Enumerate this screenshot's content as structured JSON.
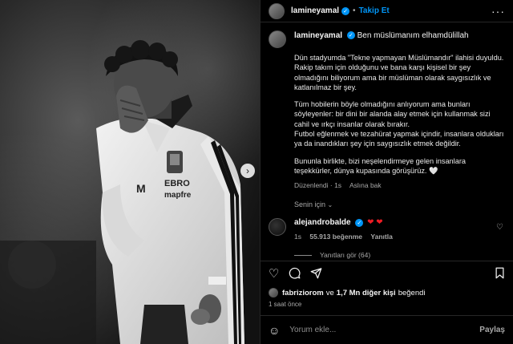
{
  "header": {
    "username": "lamineyamal",
    "separator": "•",
    "follow_label": "Takip Et",
    "more_label": "···"
  },
  "caption": {
    "username": "lamineyamal",
    "title": "Ben müslümanım elhamdülillah",
    "paragraphs": [
      "Dün stadyumda \"Tekne yapmayan Müslümandır\" ilahisi duyuldu. Rakip takım için olduğunu ve bana karşı kişisel bir şey olmadığını biliyorum ama bir müslüman olarak saygısızlık ve katlanılmaz bir şey.",
      "Tüm hobilerin böyle olmadığını anlıyorum ama bunları söyleyenler: bir dini bir alanda alay etmek için kullanmak sizi cahil ve ırkçı insanlar olarak bırakır.\nFutbol eğlenmek ve tezahürat yapmak içindir, insanlara oldukları ya da inandıkları şey için saygısızlık etmek değildir.",
      "Bununla birlikte, bizi neşelendirmeye gelen insanlara teşekkürler, dünya kupasında görüşürüz. 🤍"
    ],
    "edited": "Düzenlendi · 1s",
    "translate": "Aslına bak"
  },
  "for_you": {
    "label": "Senin için",
    "chevron": "⌄"
  },
  "comment": {
    "username": "alejandrobalde",
    "hearts": "❤ ❤",
    "time": "1s",
    "likes": "55.913 beğenme",
    "reply": "Yanıtla",
    "view_replies": "Yanıtları gör (64)"
  },
  "actions": {
    "like_icon": "heart-outline-icon",
    "comment_icon": "comment-icon",
    "share_icon": "send-icon",
    "save_icon": "bookmark-icon"
  },
  "likes": {
    "user": "fabriziorom",
    "middle": "ve",
    "others": "1,7 Mn diğer kişi",
    "suffix": "beğendi"
  },
  "time_ago": "1 saat önce",
  "comment_bar": {
    "placeholder": "Yorum ekle...",
    "share_label": "Paylaş"
  },
  "jersey": {
    "brand_line1": "EBRO",
    "brand_line2": "mapfre"
  }
}
